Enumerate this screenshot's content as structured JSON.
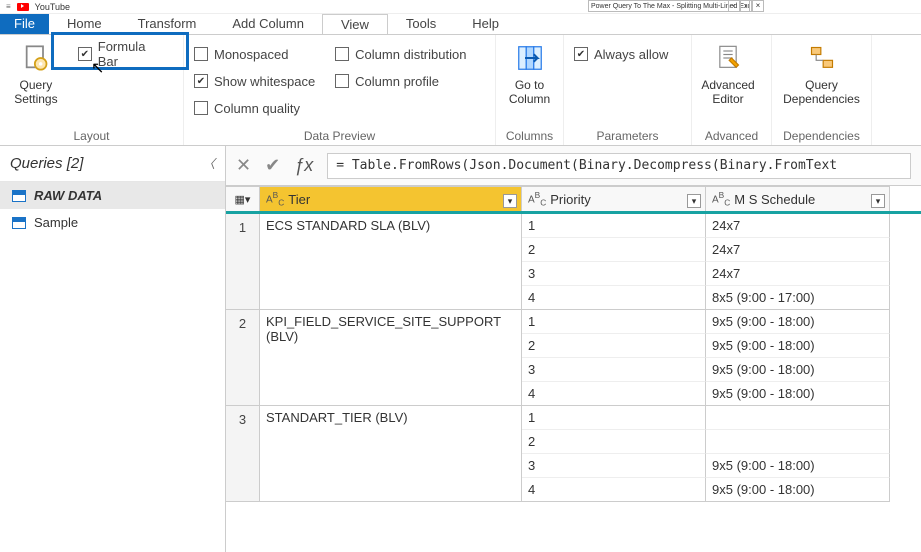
{
  "topline": {
    "youtube_label": "YouTube",
    "address": "Power Query To The Max - Splitting Multi-Lined Excel Cells In Power BI"
  },
  "tabs": {
    "file": "File",
    "items": [
      "Home",
      "Transform",
      "Add Column",
      "View",
      "Tools",
      "Help"
    ],
    "active": "View"
  },
  "ribbon": {
    "layout": {
      "query_settings": "Query\nSettings",
      "formula_bar": "Formula Bar",
      "group_label": "Layout"
    },
    "data_preview": {
      "monospaced": "Monospaced",
      "show_whitespace": "Show whitespace",
      "column_quality": "Column quality",
      "column_distribution": "Column distribution",
      "column_profile": "Column profile",
      "group_label": "Data Preview"
    },
    "columns": {
      "go_to_column": "Go to\nColumn",
      "group_label": "Columns"
    },
    "parameters": {
      "always_allow": "Always allow",
      "group_label": "Parameters"
    },
    "advanced": {
      "advanced_editor": "Advanced\nEditor",
      "group_label": "Advanced"
    },
    "dependencies": {
      "query_dependencies": "Query\nDependencies",
      "group_label": "Dependencies"
    }
  },
  "queries": {
    "header": "Queries [2]",
    "items": [
      {
        "name": "RAW DATA",
        "selected": true
      },
      {
        "name": "Sample",
        "selected": false
      }
    ]
  },
  "formula": "= Table.FromRows(Json.Document(Binary.Decompress(Binary.FromText",
  "grid": {
    "columns": [
      {
        "type": "ABC",
        "name": "Tier",
        "selected": true
      },
      {
        "type": "ABC",
        "name": "Priority",
        "selected": false
      },
      {
        "type": "ABC",
        "name": "M S Schedule",
        "selected": false
      }
    ],
    "rows": [
      {
        "idx": "1",
        "tier": "ECS STANDARD SLA (BLV)",
        "sub": [
          {
            "priority": "1",
            "ms": "24x7"
          },
          {
            "priority": "2",
            "ms": "24x7"
          },
          {
            "priority": "3",
            "ms": "24x7"
          },
          {
            "priority": "4",
            "ms": "8x5 (9:00 - 17:00)"
          }
        ]
      },
      {
        "idx": "2",
        "tier": "KPI_FIELD_SERVICE_SITE_SUPPORT (BLV)",
        "sub": [
          {
            "priority": "1",
            "ms": "9x5 (9:00 - 18:00)"
          },
          {
            "priority": "2",
            "ms": "9x5 (9:00 - 18:00)"
          },
          {
            "priority": "3",
            "ms": "9x5 (9:00 - 18:00)"
          },
          {
            "priority": "4",
            "ms": "9x5 (9:00 - 18:00)"
          }
        ]
      },
      {
        "idx": "3",
        "tier": "STANDART_TIER (BLV)",
        "sub": [
          {
            "priority": "1",
            "ms": ""
          },
          {
            "priority": "2",
            "ms": ""
          },
          {
            "priority": "3",
            "ms": "9x5 (9:00 - 18:00)"
          },
          {
            "priority": "4",
            "ms": "9x5 (9:00 - 18:00)"
          }
        ]
      }
    ]
  }
}
